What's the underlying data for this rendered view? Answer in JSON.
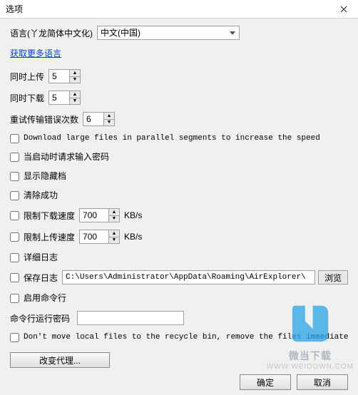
{
  "window": {
    "title": "选项"
  },
  "language": {
    "label": "语言(丫龙简体中文化)",
    "selected": "中文(中国)",
    "more_link": "获取更多语言"
  },
  "upload": {
    "label": "同时上传",
    "value": "5"
  },
  "download": {
    "label": "同时下载",
    "value": "5"
  },
  "retry": {
    "label": "重试传输错误次数",
    "value": "6"
  },
  "parallel": {
    "label": "Download large files in parallel segments to increase the speed"
  },
  "ask_password": {
    "label": "当启动时请求输入密码"
  },
  "show_hidden": {
    "label": "显示隐藏档"
  },
  "clear_success": {
    "label": "清除成功"
  },
  "limit_dl": {
    "label": "限制下载速度",
    "value": "700",
    "unit": "KB/s"
  },
  "limit_ul": {
    "label": "限制上传速度",
    "value": "700",
    "unit": "KB/s"
  },
  "verbose_log": {
    "label": "详细日志"
  },
  "save_log": {
    "label": "保存日志",
    "path": "C:\\Users\\Administrator\\AppData\\Roaming\\AirExplorer\\",
    "browse": "浏览"
  },
  "enable_cmd": {
    "label": "启用命令行"
  },
  "cmd_pass": {
    "label": "命令行运行密码",
    "value": ""
  },
  "no_recycle": {
    "label": "Don't move local files to the recycle bin, remove the files immediately when d"
  },
  "proxy_btn": "改变代理...",
  "footer": {
    "ok": "确定",
    "cancel": "取消"
  },
  "watermark": {
    "text": "微当下载",
    "url": "WWW.WEIDOWN.COM"
  }
}
